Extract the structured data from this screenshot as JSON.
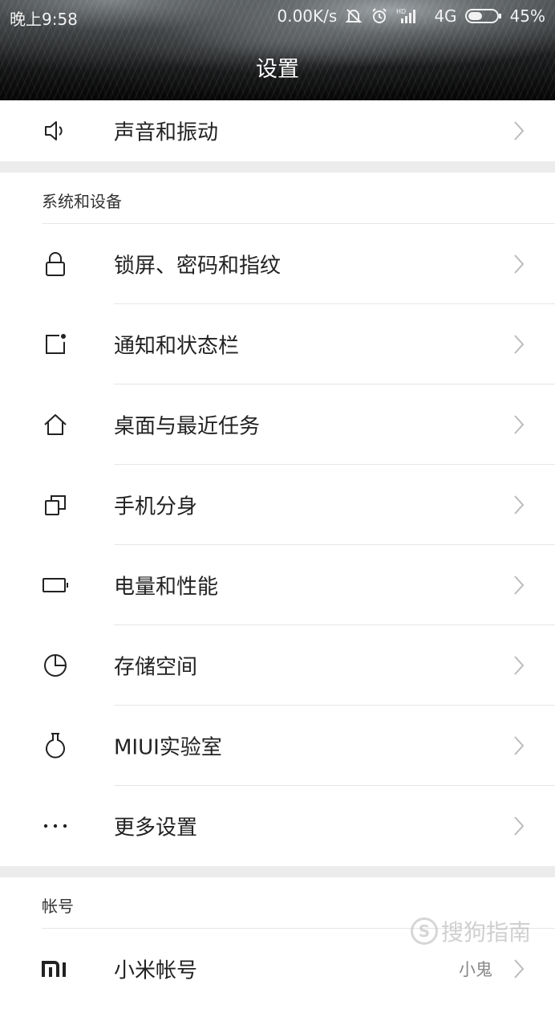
{
  "status_bar": {
    "time": "晚上9:58",
    "net_speed": "0.00K/s",
    "network": "4G",
    "battery": "45%",
    "icons": [
      "mute-notification-icon",
      "alarm-icon",
      "hd-signal-icon",
      "signal-icon",
      "battery-icon"
    ]
  },
  "page": {
    "title": "设置"
  },
  "top_row": {
    "label": "声音和振动",
    "icon": "speaker-icon"
  },
  "system_section": {
    "header": "系统和设备",
    "items": [
      {
        "label": "锁屏、密码和指纹",
        "icon": "lock-icon"
      },
      {
        "label": "通知和状态栏",
        "icon": "notification-icon"
      },
      {
        "label": "桌面与最近任务",
        "icon": "home-icon"
      },
      {
        "label": "手机分身",
        "icon": "dual-space-icon"
      },
      {
        "label": "电量和性能",
        "icon": "battery-icon"
      },
      {
        "label": "存储空间",
        "icon": "storage-pie-icon"
      },
      {
        "label": "MIUI实验室",
        "icon": "lab-flask-icon"
      },
      {
        "label": "更多设置",
        "icon": "more-dots-icon"
      }
    ]
  },
  "account_section": {
    "header": "帐号",
    "items": [
      {
        "label": "小米帐号",
        "value": "小鬼",
        "icon": "mi-logo-icon"
      }
    ]
  },
  "watermark": {
    "text": "搜狗指南"
  }
}
